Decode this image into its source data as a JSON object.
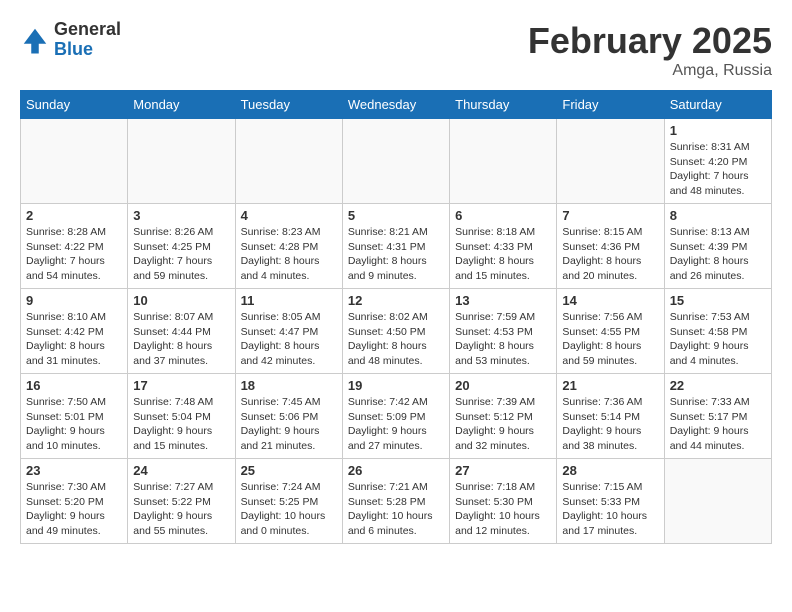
{
  "header": {
    "logo_general": "General",
    "logo_blue": "Blue",
    "month_title": "February 2025",
    "location": "Amga, Russia"
  },
  "weekdays": [
    "Sunday",
    "Monday",
    "Tuesday",
    "Wednesday",
    "Thursday",
    "Friday",
    "Saturday"
  ],
  "weeks": [
    [
      {
        "day": "",
        "info": ""
      },
      {
        "day": "",
        "info": ""
      },
      {
        "day": "",
        "info": ""
      },
      {
        "day": "",
        "info": ""
      },
      {
        "day": "",
        "info": ""
      },
      {
        "day": "",
        "info": ""
      },
      {
        "day": "1",
        "info": "Sunrise: 8:31 AM\nSunset: 4:20 PM\nDaylight: 7 hours and 48 minutes."
      }
    ],
    [
      {
        "day": "2",
        "info": "Sunrise: 8:28 AM\nSunset: 4:22 PM\nDaylight: 7 hours and 54 minutes."
      },
      {
        "day": "3",
        "info": "Sunrise: 8:26 AM\nSunset: 4:25 PM\nDaylight: 7 hours and 59 minutes."
      },
      {
        "day": "4",
        "info": "Sunrise: 8:23 AM\nSunset: 4:28 PM\nDaylight: 8 hours and 4 minutes."
      },
      {
        "day": "5",
        "info": "Sunrise: 8:21 AM\nSunset: 4:31 PM\nDaylight: 8 hours and 9 minutes."
      },
      {
        "day": "6",
        "info": "Sunrise: 8:18 AM\nSunset: 4:33 PM\nDaylight: 8 hours and 15 minutes."
      },
      {
        "day": "7",
        "info": "Sunrise: 8:15 AM\nSunset: 4:36 PM\nDaylight: 8 hours and 20 minutes."
      },
      {
        "day": "8",
        "info": "Sunrise: 8:13 AM\nSunset: 4:39 PM\nDaylight: 8 hours and 26 minutes."
      }
    ],
    [
      {
        "day": "9",
        "info": "Sunrise: 8:10 AM\nSunset: 4:42 PM\nDaylight: 8 hours and 31 minutes."
      },
      {
        "day": "10",
        "info": "Sunrise: 8:07 AM\nSunset: 4:44 PM\nDaylight: 8 hours and 37 minutes."
      },
      {
        "day": "11",
        "info": "Sunrise: 8:05 AM\nSunset: 4:47 PM\nDaylight: 8 hours and 42 minutes."
      },
      {
        "day": "12",
        "info": "Sunrise: 8:02 AM\nSunset: 4:50 PM\nDaylight: 8 hours and 48 minutes."
      },
      {
        "day": "13",
        "info": "Sunrise: 7:59 AM\nSunset: 4:53 PM\nDaylight: 8 hours and 53 minutes."
      },
      {
        "day": "14",
        "info": "Sunrise: 7:56 AM\nSunset: 4:55 PM\nDaylight: 8 hours and 59 minutes."
      },
      {
        "day": "15",
        "info": "Sunrise: 7:53 AM\nSunset: 4:58 PM\nDaylight: 9 hours and 4 minutes."
      }
    ],
    [
      {
        "day": "16",
        "info": "Sunrise: 7:50 AM\nSunset: 5:01 PM\nDaylight: 9 hours and 10 minutes."
      },
      {
        "day": "17",
        "info": "Sunrise: 7:48 AM\nSunset: 5:04 PM\nDaylight: 9 hours and 15 minutes."
      },
      {
        "day": "18",
        "info": "Sunrise: 7:45 AM\nSunset: 5:06 PM\nDaylight: 9 hours and 21 minutes."
      },
      {
        "day": "19",
        "info": "Sunrise: 7:42 AM\nSunset: 5:09 PM\nDaylight: 9 hours and 27 minutes."
      },
      {
        "day": "20",
        "info": "Sunrise: 7:39 AM\nSunset: 5:12 PM\nDaylight: 9 hours and 32 minutes."
      },
      {
        "day": "21",
        "info": "Sunrise: 7:36 AM\nSunset: 5:14 PM\nDaylight: 9 hours and 38 minutes."
      },
      {
        "day": "22",
        "info": "Sunrise: 7:33 AM\nSunset: 5:17 PM\nDaylight: 9 hours and 44 minutes."
      }
    ],
    [
      {
        "day": "23",
        "info": "Sunrise: 7:30 AM\nSunset: 5:20 PM\nDaylight: 9 hours and 49 minutes."
      },
      {
        "day": "24",
        "info": "Sunrise: 7:27 AM\nSunset: 5:22 PM\nDaylight: 9 hours and 55 minutes."
      },
      {
        "day": "25",
        "info": "Sunrise: 7:24 AM\nSunset: 5:25 PM\nDaylight: 10 hours and 0 minutes."
      },
      {
        "day": "26",
        "info": "Sunrise: 7:21 AM\nSunset: 5:28 PM\nDaylight: 10 hours and 6 minutes."
      },
      {
        "day": "27",
        "info": "Sunrise: 7:18 AM\nSunset: 5:30 PM\nDaylight: 10 hours and 12 minutes."
      },
      {
        "day": "28",
        "info": "Sunrise: 7:15 AM\nSunset: 5:33 PM\nDaylight: 10 hours and 17 minutes."
      },
      {
        "day": "",
        "info": ""
      }
    ]
  ]
}
